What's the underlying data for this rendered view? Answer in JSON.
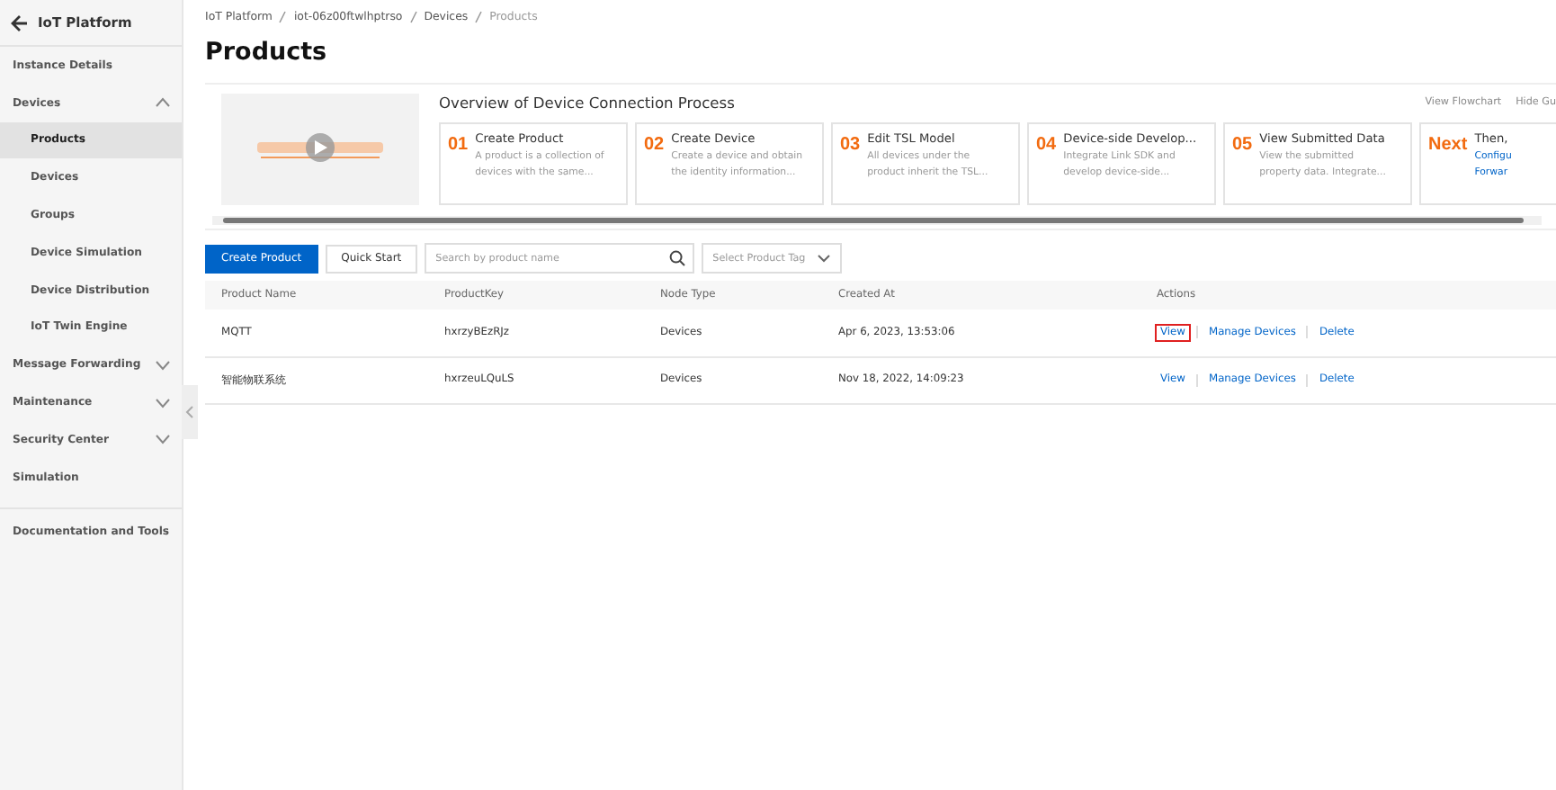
{
  "sidebar": {
    "back_label": "IoT Platform",
    "items": [
      {
        "label": "Instance Details",
        "selected": false
      },
      {
        "label": "Devices",
        "selected": false,
        "expanded": true,
        "children": [
          {
            "label": "Products",
            "selected": true
          },
          {
            "label": "Devices",
            "selected": false
          },
          {
            "label": "Groups",
            "selected": false
          },
          {
            "label": "Device Simulation",
            "selected": false
          },
          {
            "label": "Device Distribution",
            "selected": false
          },
          {
            "label": "IoT Twin Engine",
            "selected": false
          }
        ]
      },
      {
        "label": "Message Forwarding",
        "selected": false,
        "expanded": false
      },
      {
        "label": "Maintenance",
        "selected": false,
        "expanded": false
      },
      {
        "label": "Security Center",
        "selected": false,
        "expanded": false
      },
      {
        "label": "Simulation",
        "selected": false
      },
      {
        "label": "Documentation and Tools",
        "selected": false,
        "kind": "footer"
      }
    ]
  },
  "breadcrumb": [
    "IoT Platform",
    "iot-06z00ftwlhptrso",
    "Devices",
    "Products"
  ],
  "page_title": "Products",
  "guide": {
    "video": {
      "kind": "picture"
    },
    "title": "Overview of Device Connection Process",
    "links": [
      "View Flowchart",
      "Hide Gu"
    ],
    "steps": [
      {
        "number": "01",
        "title": "Create Product",
        "lines": [
          "A product is a collection of",
          "devices with the same..."
        ]
      },
      {
        "number": "02",
        "title": "Create Device",
        "lines": [
          "Create a device and obtain",
          "the identity information..."
        ]
      },
      {
        "number": "03",
        "title": "Edit TSL Model",
        "lines": [
          "All devices under the",
          "product inherit the TSL..."
        ]
      },
      {
        "number": "04",
        "title": "Device-side Develop...",
        "lines": [
          "Integrate Link SDK and",
          "develop device-side..."
        ]
      },
      {
        "number": "05",
        "title": "View Submitted Data",
        "lines": [
          "View the submitted",
          "property data. Integrate..."
        ]
      },
      {
        "number": "Next",
        "title": "Then,",
        "links": [
          "Configu",
          "Forwar"
        ]
      }
    ]
  },
  "toolbar": {
    "primary": "Create Product",
    "secondary": "Quick Start",
    "search": {
      "placeholder": "Search by product name"
    },
    "tag_select": {
      "placeholder": "Select Product Tag"
    }
  },
  "table": {
    "columns": [
      "Product Name",
      "ProductKey",
      "Node Type",
      "Created At",
      "Actions"
    ],
    "rows": [
      {
        "cells": [
          "MQTT",
          "hxrzyBEzRJz",
          "Devices",
          "Apr 6, 2023, 13:53:06"
        ],
        "actions": [
          "View",
          "Manage Devices",
          "Delete"
        ],
        "view_highlighted": true
      },
      {
        "cells": [
          "智能物联系统",
          "hxrzeuLQuLS",
          "Devices",
          "Nov 18, 2022, 14:09:23"
        ],
        "actions": [
          "View",
          "Manage Devices",
          "Delete"
        ],
        "view_highlighted": false
      }
    ]
  }
}
